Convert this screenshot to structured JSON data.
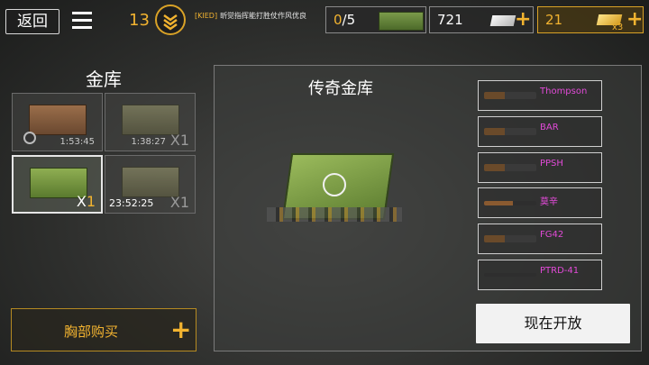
{
  "topbar": {
    "back_label": "返回",
    "level": "13",
    "player_clan": "[KIED]",
    "player_name": "昕觉指挥能打胜仗作风优良",
    "chests": {
      "current": "0",
      "max": "/5"
    },
    "silver": "721",
    "gold": "21",
    "gold_multiplier": "x3"
  },
  "vault": {
    "title": "金库",
    "slots": [
      {
        "timer": "1:53:45",
        "crate": "wood",
        "has_clock": true,
        "selected": false
      },
      {
        "timer": "1:38:27",
        "count": "X1",
        "crate": "olive",
        "selected": false
      },
      {
        "count_x": "X",
        "count_n": "1",
        "crate": "green",
        "selected": true
      },
      {
        "timer": "23:52:25",
        "count": "X1",
        "crate": "olive",
        "selected": false
      }
    ],
    "buy_label": "胸部购买"
  },
  "detail": {
    "title": "传奇金库",
    "weapons": [
      {
        "name": "Thompson",
        "icon": "smg-icon"
      },
      {
        "name": "BAR",
        "icon": "rifle-icon"
      },
      {
        "name": "PPSH",
        "icon": "smg-icon"
      },
      {
        "name": "莫辛",
        "icon": "bolt-rifle-icon"
      },
      {
        "name": "FG42",
        "icon": "rifle-icon"
      },
      {
        "name": "PTRD-41",
        "icon": "anti-tank-rifle-icon"
      }
    ],
    "open_label": "现在开放"
  },
  "colors": {
    "accent": "#f2b330",
    "legendary": "#e24ad8",
    "crate_green": "#7a9a4a"
  }
}
